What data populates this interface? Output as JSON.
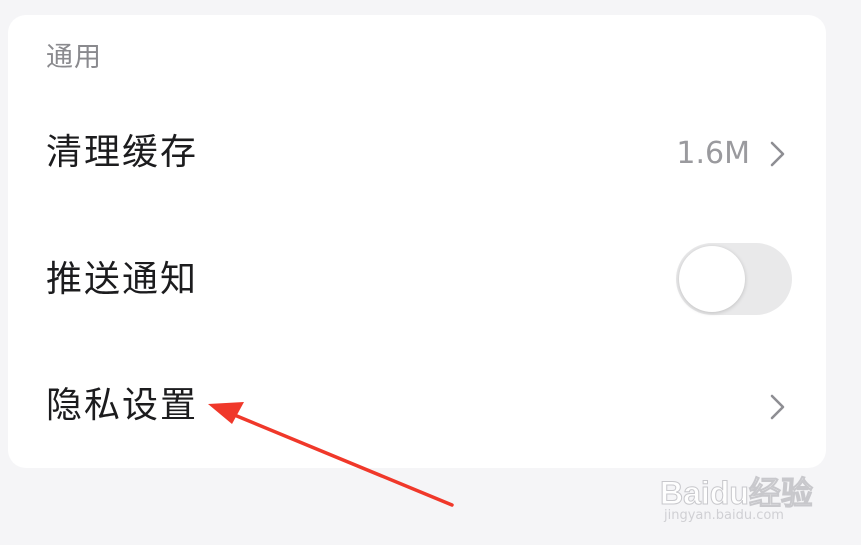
{
  "section": {
    "title": "通用"
  },
  "rows": [
    {
      "label": "清理缓存",
      "value": "1.6M",
      "has_chevron": true
    },
    {
      "label": "推送通知",
      "toggle_on": false
    },
    {
      "label": "隐私设置",
      "has_chevron": true
    }
  ],
  "icons": {
    "chevron": "chevron-right-icon"
  },
  "annotation": {
    "arrow_color": "#f0382a"
  },
  "watermark": {
    "main": "Baidu经验",
    "sub": "jingyan.baidu.com"
  },
  "colors": {
    "background": "#f5f5f7",
    "card": "#ffffff",
    "label": "#1c1c1e",
    "secondary": "#8a8a8e",
    "toggle_off": "#e9e9ea"
  }
}
